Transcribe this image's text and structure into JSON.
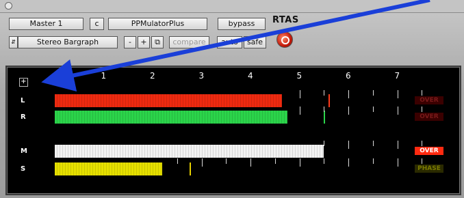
{
  "toolbar": {
    "track": "Master 1",
    "c_label": "c",
    "plugin": "PPMulatorPlus",
    "bypass": "bypass",
    "format": "RTAS",
    "preset": "Stereo Bargraph",
    "minus": "-",
    "plus": "+",
    "copy_icon": "copy-icon",
    "compare": "compare",
    "auto": "auto",
    "safe": "safe"
  },
  "meter": {
    "scale_labels": [
      "1",
      "2",
      "3",
      "4",
      "5",
      "6",
      "7"
    ],
    "scale_max": 7.7,
    "channels": [
      {
        "label": "L",
        "level": 4.65,
        "peak": 5.6,
        "bar_color": "#ee2a10",
        "peak_color": "#ff3a1a",
        "indicator": "OVER",
        "indicator_color": "#3a0000",
        "indicator_text": "#7a1a1a"
      },
      {
        "label": "R",
        "level": 4.75,
        "peak": 5.5,
        "bar_color": "#2bd44a",
        "peak_color": "#2bd44a",
        "indicator": "OVER",
        "indicator_color": "#3a0000",
        "indicator_text": "#7a1a1a"
      },
      {
        "label": "M",
        "level": 5.5,
        "peak": null,
        "bar_color": "#f2f2f2",
        "peak_color": null,
        "indicator": "OVER",
        "indicator_color": "#ff2a10",
        "indicator_text": "#ffffff"
      },
      {
        "label": "S",
        "level": 2.2,
        "peak": 2.75,
        "bar_color": "#e6e000",
        "peak_color": "#e6d000",
        "indicator": "PHASE",
        "indicator_color": "#2a2a00",
        "indicator_text": "#7a7a00"
      }
    ]
  }
}
